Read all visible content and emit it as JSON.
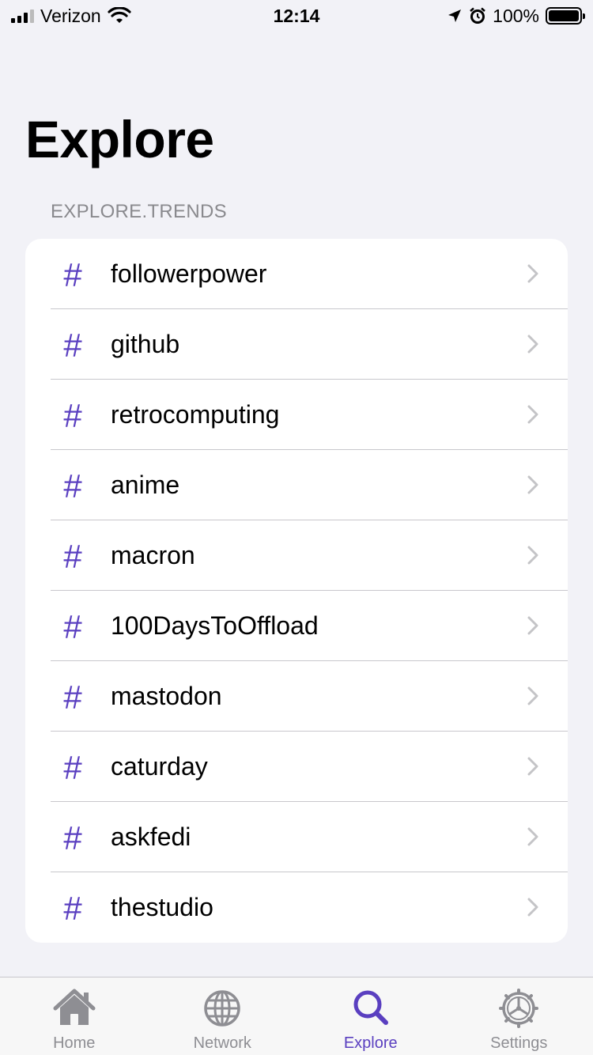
{
  "status_bar": {
    "carrier": "Verizon",
    "time": "12:14",
    "battery": "100%"
  },
  "page": {
    "title": "Explore",
    "section_header": "EXPLORE.TRENDS"
  },
  "trends": [
    {
      "label": "followerpower"
    },
    {
      "label": "github"
    },
    {
      "label": "retrocomputing"
    },
    {
      "label": "anime"
    },
    {
      "label": "macron"
    },
    {
      "label": "100DaysToOffload"
    },
    {
      "label": "mastodon"
    },
    {
      "label": "caturday"
    },
    {
      "label": "askfedi"
    },
    {
      "label": "thestudio"
    }
  ],
  "hash_symbol": "#",
  "tabs": [
    {
      "label": "Home",
      "icon": "home-icon"
    },
    {
      "label": "Network",
      "icon": "globe-icon"
    },
    {
      "label": "Explore",
      "icon": "search-icon",
      "active": true
    },
    {
      "label": "Settings",
      "icon": "gear-icon"
    }
  ],
  "colors": {
    "accent": "#5a3fc0",
    "background": "#f2f2f7",
    "inactive_tab": "#8e8e93"
  }
}
